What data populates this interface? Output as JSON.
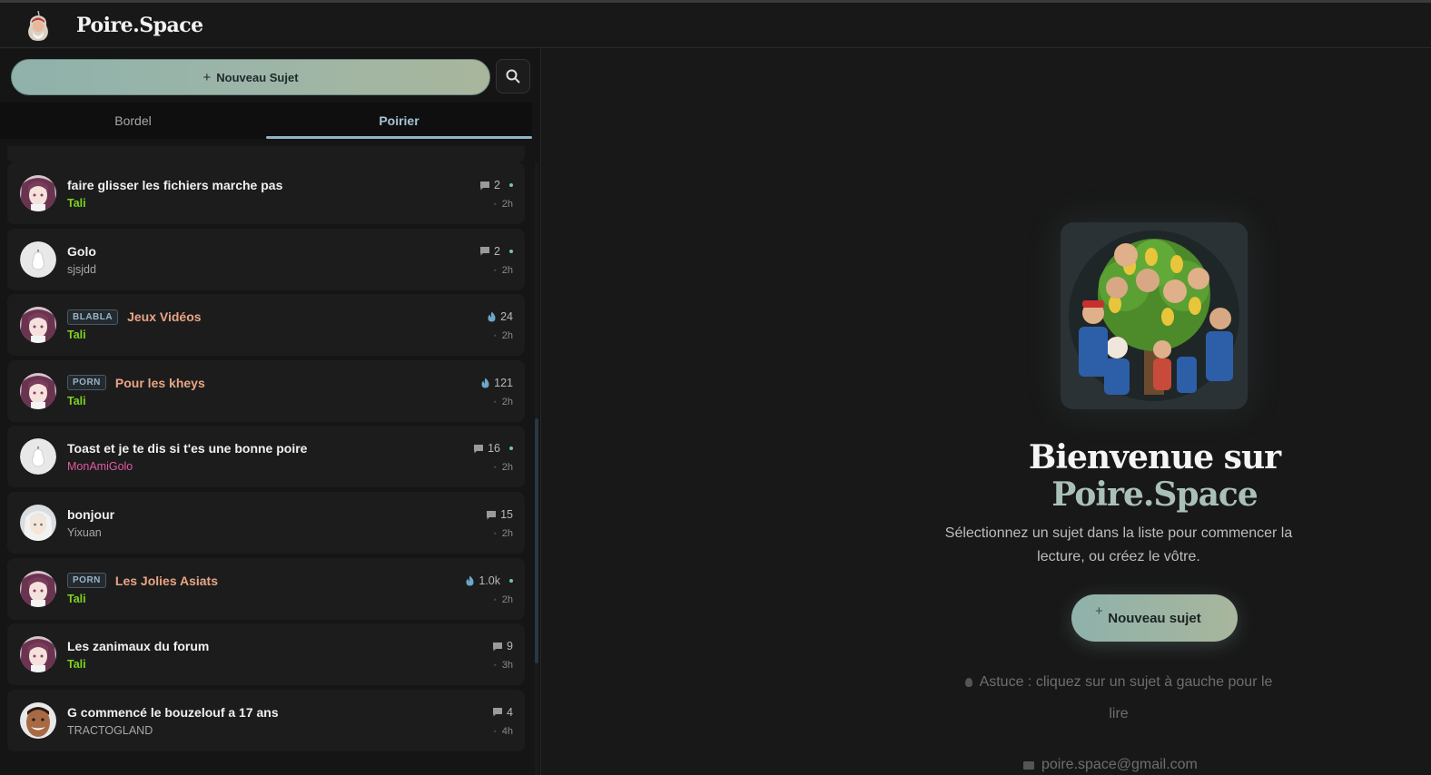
{
  "app": {
    "brand": "Poire.Space"
  },
  "sidebar": {
    "new_topic_label": "Nouveau Sujet",
    "tabs": [
      {
        "label": "Bordel",
        "active": false
      },
      {
        "label": "Poirier",
        "active": true
      }
    ],
    "topics": [
      {
        "title": "faire glisser les fichiers marche pas",
        "author": "Tali",
        "author_style": "green",
        "count_icon": "comment-icon",
        "count": "2",
        "unread": true,
        "time": "2h",
        "avatar": "anime-girl"
      },
      {
        "title": "Golo",
        "author": "sjsjdd",
        "author_style": "gray",
        "count_icon": "comment-icon",
        "count": "2",
        "unread": true,
        "time": "2h",
        "avatar": "pear"
      },
      {
        "tag": "BLABLA",
        "title": "Jeux Vidéos",
        "title_style": "salmon",
        "author": "Tali",
        "author_style": "green",
        "count_icon": "fire-icon",
        "count": "24",
        "unread": false,
        "time": "2h",
        "avatar": "anime-girl"
      },
      {
        "tag": "PORN",
        "title": "Pour les kheys",
        "title_style": "salmon",
        "author": "Tali",
        "author_style": "green",
        "count_icon": "fire-icon",
        "count": "121",
        "unread": false,
        "time": "2h",
        "avatar": "anime-girl"
      },
      {
        "title": "Toast et je te dis si t'es une bonne poire",
        "author": "MonAmiGolo",
        "author_style": "pink",
        "count_icon": "comment-icon",
        "count": "16",
        "unread": true,
        "time": "2h",
        "avatar": "pear"
      },
      {
        "title": "bonjour",
        "author": "Yixuan",
        "author_style": "gray",
        "count_icon": "comment-icon",
        "count": "15",
        "unread": false,
        "time": "2h",
        "avatar": "white-hair"
      },
      {
        "tag": "PORN",
        "title": "Les Jolies Asiats",
        "title_style": "salmon",
        "author": "Tali",
        "author_style": "green",
        "count_icon": "fire-icon",
        "count": "1.0k",
        "unread": true,
        "time": "2h",
        "avatar": "anime-girl"
      },
      {
        "title": "Les zanimaux du forum",
        "author": "Tali",
        "author_style": "green",
        "count_icon": "comment-icon",
        "count": "9",
        "unread": false,
        "time": "3h",
        "avatar": "anime-girl"
      },
      {
        "title": "G commencé le bouzelouf a 17 ans",
        "author": "TRACTOGLAND",
        "author_style": "gray",
        "count_icon": "comment-icon",
        "count": "4",
        "unread": false,
        "time": "4h",
        "avatar": "man"
      }
    ]
  },
  "main": {
    "welcome_line1": "Bienvenue sur",
    "welcome_line2": "Poire.Space",
    "subtitle": "Sélectionnez un sujet dans la liste pour commencer la lecture, ou créez le vôtre.",
    "cta_label": "Nouveau sujet",
    "tip": "Astuce : cliquez sur un sujet à gauche pour le lire",
    "email": "poire.space@gmail.com"
  },
  "colors": {
    "accent": "#8eb4c6",
    "author_green": "#7ed321",
    "author_pink": "#e05aa0",
    "salmon_title": "#e8a585"
  }
}
